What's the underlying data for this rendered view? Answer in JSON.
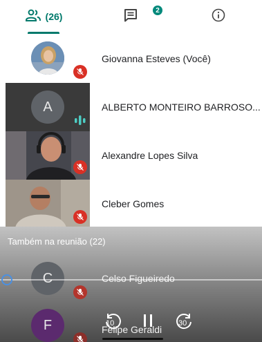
{
  "tabs": {
    "people_count": "(26)",
    "chat_badge": "2"
  },
  "participants": [
    {
      "name": "Giovanna Esteves (Você)",
      "muted": true
    },
    {
      "name": "ALBERTO MONTEIRO BARROSO...",
      "initial": "A",
      "speaking": true
    },
    {
      "name": "Alexandre Lopes Silva",
      "muted": true
    },
    {
      "name": "Cleber Gomes",
      "muted": true
    }
  ],
  "section": {
    "title": "Também na reunião (22)"
  },
  "others": [
    {
      "name": "Celso Figueiredo",
      "initial": "C",
      "muted": true
    },
    {
      "name": "Felipe Geraldi",
      "initial": "F",
      "muted": true
    }
  ],
  "player": {
    "rewind_label": "10",
    "forward_label": "30"
  },
  "colors": {
    "accent": "#00796b",
    "mute_red": "#d93025",
    "speaking_teal": "#4ecdc4"
  }
}
